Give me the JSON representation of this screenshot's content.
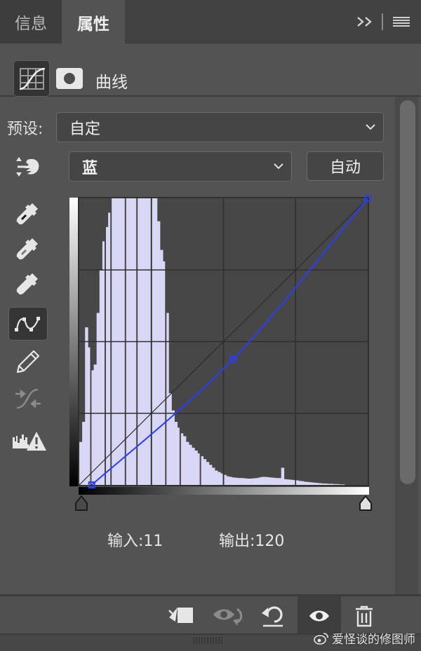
{
  "tabs": [
    {
      "label": "信息",
      "active": false
    },
    {
      "label": "属性",
      "active": true
    }
  ],
  "tab_tools": {
    "expand_icon": "double-chevron-right-icon",
    "menu_icon": "hamburger-menu-icon"
  },
  "adjustment": {
    "type_icon": "curves-adjustment-icon",
    "mask_icon": "layer-mask-icon",
    "title": "曲线"
  },
  "preset": {
    "label": "预设:",
    "value": "自定"
  },
  "channel": {
    "value": "蓝",
    "auto_label": "自动"
  },
  "tools": [
    {
      "name": "on-image-adjust-icon",
      "active": false
    },
    {
      "name": "black-point-eyedropper-icon",
      "active": false
    },
    {
      "name": "gray-point-eyedropper-icon",
      "active": false
    },
    {
      "name": "white-point-eyedropper-icon",
      "active": false
    },
    {
      "name": "curve-points-tool-icon",
      "active": true
    },
    {
      "name": "pencil-draw-icon",
      "active": false
    },
    {
      "name": "smooth-curve-icon",
      "active": false
    },
    {
      "name": "clipping-warning-icon",
      "active": false
    }
  ],
  "curve": {
    "channel_color": "#2a3dff",
    "histogram_color": "#d8d8f6",
    "points": [
      [
        11,
        0
      ],
      [
        136,
        112
      ],
      [
        255,
        255
      ]
    ],
    "histogram": [
      0.15,
      0.22,
      0.55,
      0.48,
      0.4,
      0.42,
      0.6,
      0.75,
      0.85,
      0.9,
      0.95,
      1,
      1,
      1,
      1,
      1,
      1,
      1,
      1,
      1,
      1,
      1,
      1,
      1,
      1,
      1,
      1,
      0.92,
      0.82,
      0.78,
      0.6,
      0.32,
      0.26,
      0.22,
      0.2,
      0.18,
      0.17,
      0.15,
      0.14,
      0.13,
      0.12,
      0.11,
      0.1,
      0.09,
      0.08,
      0.07,
      0.06,
      0.05,
      0.045,
      0.04,
      0.035,
      0.03,
      0.028,
      0.026,
      0.025,
      0.024,
      0.024,
      0.023,
      0.022,
      0.022,
      0.023,
      0.024,
      0.026,
      0.028,
      0.028,
      0.027,
      0.026,
      0.025,
      0.024,
      0.024,
      0.06,
      0.02,
      0.019,
      0.018,
      0.017,
      0.016,
      0.014,
      0.013,
      0.011,
      0.01,
      0.009,
      0.008,
      0.007,
      0.006,
      0.005,
      0.005,
      0.004,
      0.004,
      0.003,
      0.003,
      0.002,
      0.002,
      0,
      0,
      0,
      0,
      0,
      0,
      0,
      0
    ]
  },
  "readout": {
    "input": "输入:11",
    "output": "输出:120"
  },
  "footer": {
    "clip_icon": "clip-to-layer-icon",
    "view_previous_icon": "view-previous-state-icon",
    "reset_icon": "reset-icon",
    "visibility_icon": "eye-icon",
    "delete_icon": "trash-icon"
  },
  "watermark": "爱怪谈的修图师"
}
